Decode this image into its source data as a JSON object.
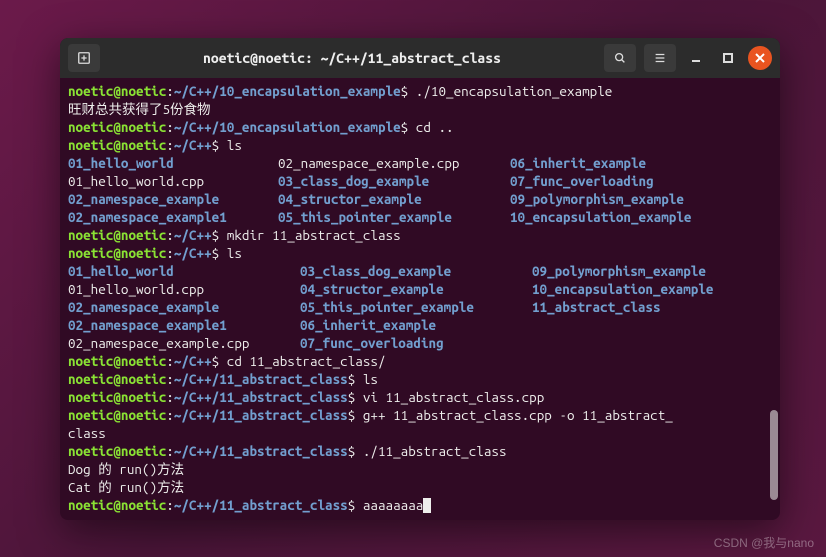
{
  "window": {
    "title": "noetic@noetic: ~/C++/11_abstract_class"
  },
  "session": {
    "user_host": "noetic@noetic",
    "prompt_char": "$"
  },
  "lines": {
    "l0_path": "~/C++/10_encapsulation_example",
    "l0_cmd": "./10_encapsulation_example",
    "l1_out": "旺财总共获得了5份食物",
    "l2_path": "~/C++/10_encapsulation_example",
    "l2_cmd": "cd ..",
    "l3_path": "~/C++",
    "l3_cmd": "ls",
    "ls1": {
      "r0": {
        "c0": "01_hello_world",
        "c1": "02_namespace_example.cpp",
        "c2": "06_inherit_example"
      },
      "r1": {
        "c0": "01_hello_world.cpp",
        "c1": "03_class_dog_example",
        "c2": "07_func_overloading"
      },
      "r2": {
        "c0": "02_namespace_example",
        "c1": "04_structor_example",
        "c2": "09_polymorphism_example"
      },
      "r3": {
        "c0": "02_namespace_example1",
        "c1": "05_this_pointer_example",
        "c2": "10_encapsulation_example"
      }
    },
    "l8_path": "~/C++",
    "l8_cmd": "mkdir 11_abstract_class",
    "l9_path": "~/C++",
    "l9_cmd": "ls",
    "ls2": {
      "r0": {
        "c0": "01_hello_world",
        "c1": "03_class_dog_example",
        "c2": "09_polymorphism_example"
      },
      "r1": {
        "c0": "01_hello_world.cpp",
        "c1": "04_structor_example",
        "c2": "10_encapsulation_example"
      },
      "r2": {
        "c0": "02_namespace_example",
        "c1": "05_this_pointer_example",
        "c2": "11_abstract_class"
      },
      "r3": {
        "c0": "02_namespace_example1",
        "c1": "06_inherit_example",
        "c2": ""
      },
      "r4": {
        "c0": "02_namespace_example.cpp",
        "c1": "07_func_overloading",
        "c2": ""
      }
    },
    "l15_path": "~/C++",
    "l15_cmd": "cd 11_abstract_class/",
    "l16_path": "~/C++/11_abstract_class",
    "l16_cmd": "ls",
    "l17_path": "~/C++/11_abstract_class",
    "l17_cmd": "vi 11_abstract_class.cpp",
    "l18_path": "~/C++/11_abstract_class",
    "l18_cmd": "g++ 11_abstract_class.cpp -o 11_abstract_",
    "l18b_cmd": "class",
    "l19_path": "~/C++/11_abstract_class",
    "l19_cmd": "./11_abstract_class",
    "l20_out": "Dog 的 run()方法",
    "l21_out": "Cat 的 run()方法",
    "l22_path": "~/C++/11_abstract_class",
    "l22_cmd": "aaaaaaaa"
  },
  "watermark": "CSDN @我与nano"
}
